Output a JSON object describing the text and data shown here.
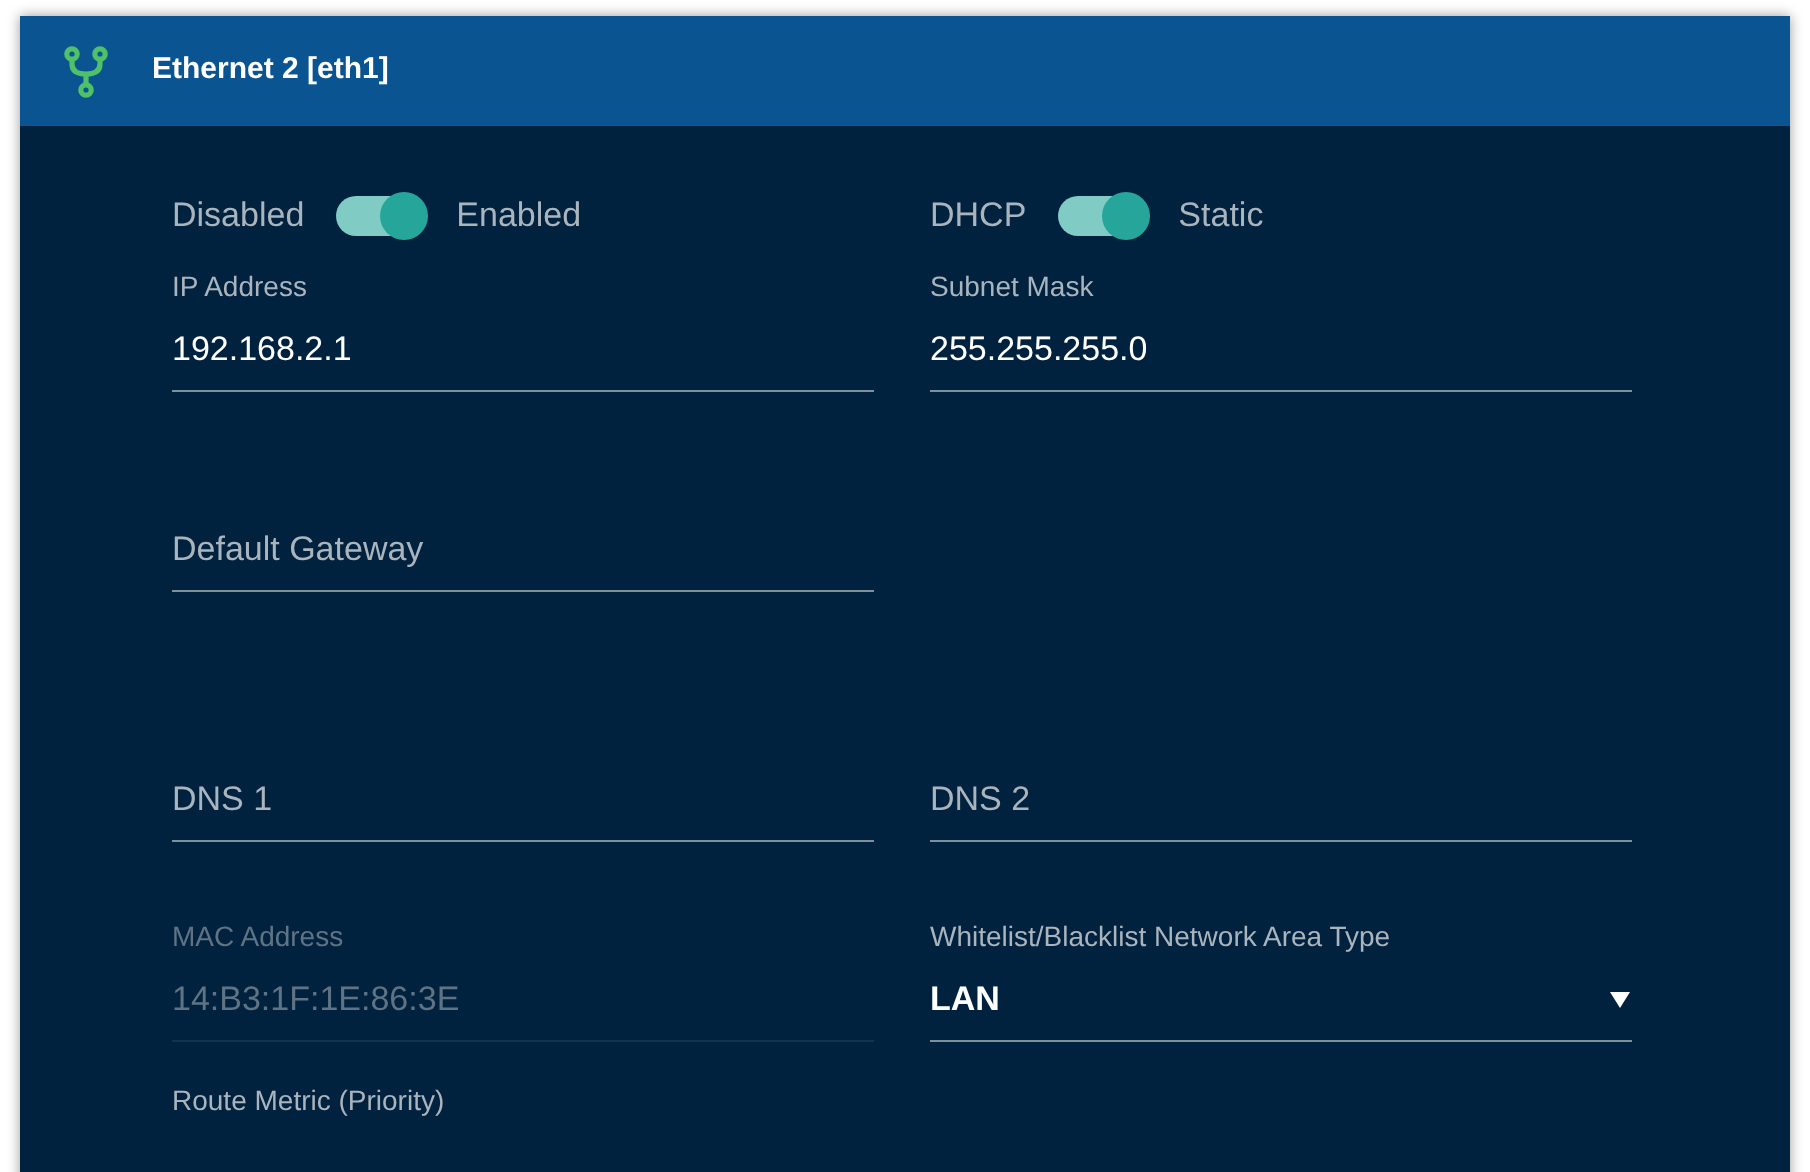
{
  "panel": {
    "title": "Ethernet 2 [eth1]"
  },
  "toggles": [
    {
      "off_label": "Disabled",
      "on_label": "Enabled",
      "on": true
    },
    {
      "off_label": "DHCP",
      "on_label": "Static",
      "on": true
    }
  ],
  "rows": [
    {
      "fields": [
        {
          "kind": "text",
          "label": "IP Address",
          "value": "192.168.2.1",
          "disabled": false
        },
        {
          "kind": "text",
          "label": "Subnet Mask",
          "value": "255.255.255.0",
          "disabled": false
        }
      ]
    },
    {
      "fields": [
        {
          "kind": "text",
          "placeholder": "Default Gateway",
          "disabled": false
        }
      ]
    },
    {
      "fields": [
        {
          "kind": "text",
          "placeholder": "DNS 1",
          "disabled": false
        },
        {
          "kind": "text",
          "placeholder": "DNS 2",
          "disabled": false
        }
      ]
    },
    {
      "fields": [
        {
          "kind": "text",
          "label": "MAC Address",
          "value": "14:B3:1F:1E:86:3E",
          "disabled": true
        },
        {
          "kind": "select",
          "label": "Whitelist/Blacklist Network Area Type",
          "value": "LAN",
          "disabled": false
        }
      ]
    },
    {
      "fields": [
        {
          "kind": "heading",
          "label": "Route Metric (Priority)"
        }
      ]
    }
  ]
}
